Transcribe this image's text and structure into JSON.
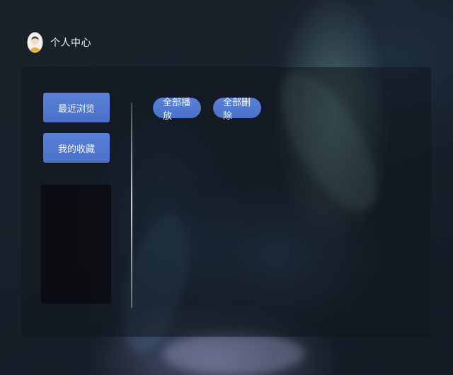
{
  "header": {
    "avatar_icon": "user-avatar-icon",
    "title": "个人中心"
  },
  "sidebar": {
    "items": [
      {
        "label": "最近浏览"
      },
      {
        "label": "我的收藏"
      }
    ]
  },
  "toolbar": {
    "play_all_label": "全部播放",
    "delete_all_label": "全部删除"
  },
  "colors": {
    "accent": "#4f76cf",
    "panel": "#10161e",
    "text": "#f2f4f7"
  }
}
